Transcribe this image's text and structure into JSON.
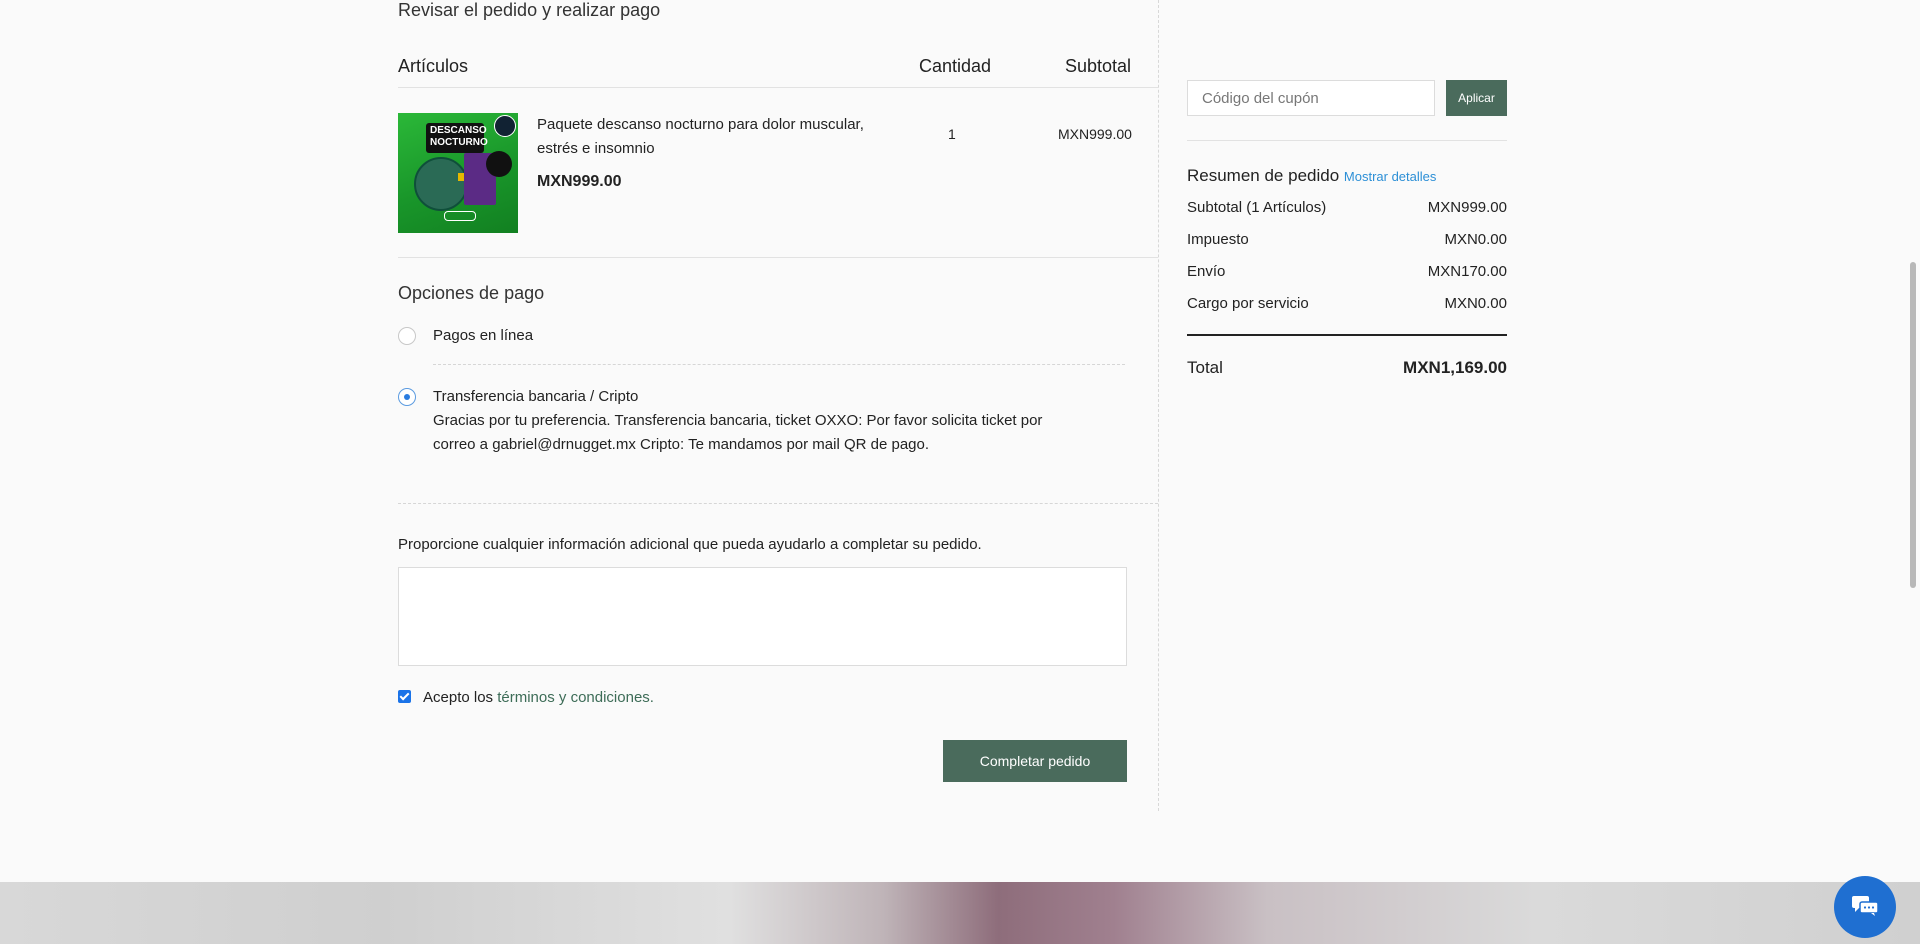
{
  "page": {
    "title": "Revisar el pedido y realizar pago"
  },
  "table": {
    "col_items": "Artículos",
    "col_qty": "Cantidad",
    "col_subtotal": "Subtotal"
  },
  "product": {
    "name": "Paquete descanso nocturno para dolor muscular, estrés e insomnio",
    "price": "MXN999.00",
    "quantity": "1",
    "subtotal": "MXN999.00",
    "image_text": "DESCANSO NOCTURNO"
  },
  "payment": {
    "heading": "Opciones de pago",
    "options": [
      {
        "label": "Pagos en línea",
        "selected": false
      },
      {
        "label": "Transferencia bancaria / Cripto",
        "selected": true,
        "description": "Gracias por tu preferencia. Transferencia bancaria, ticket OXXO: Por favor solicita ticket por correo a gabriel@drnugget.mx Cripto: Te mandamos por mail QR de pago."
      }
    ]
  },
  "notes": {
    "label": "Proporcione cualquier información adicional que pueda ayudarlo a completar su pedido.",
    "value": ""
  },
  "terms": {
    "prefix": "Acepto los",
    "link": "términos y condiciones.",
    "checked": true
  },
  "submit_label": "Completar pedido",
  "coupon": {
    "placeholder": "Código del cupón",
    "apply_label": "Aplicar"
  },
  "summary": {
    "heading": "Resumen de pedido",
    "details_link": "Mostrar detalles",
    "rows": [
      {
        "label": "Subtotal (1 Artículos)",
        "value": "MXN999.00"
      },
      {
        "label": "Impuesto",
        "value": "MXN0.00"
      },
      {
        "label": "Envío",
        "value": "MXN170.00"
      },
      {
        "label": "Cargo por servicio",
        "value": "MXN0.00"
      }
    ],
    "total_label": "Total",
    "total_value": "MXN1,169.00"
  },
  "colors": {
    "accent_green": "#4a6b5c",
    "link_blue": "#2c8fd6",
    "radio_blue": "#2a7ce0",
    "chat_blue": "#1f6fd1"
  }
}
